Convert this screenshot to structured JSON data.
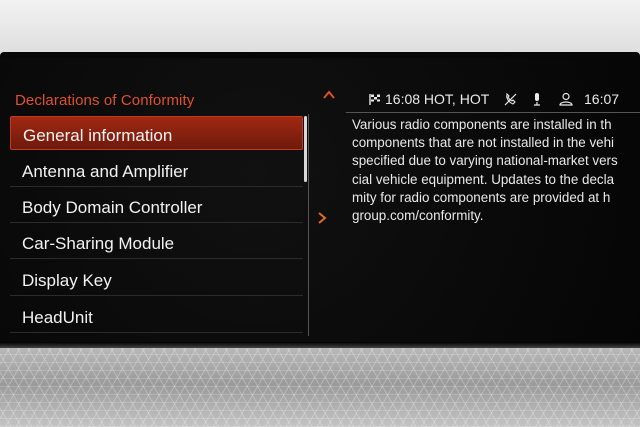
{
  "menu": {
    "title": "Declarations of Conformity",
    "items": [
      {
        "label": "General information",
        "selected": true
      },
      {
        "label": "Antenna and Amplifier",
        "selected": false
      },
      {
        "label": "Body Domain Controller",
        "selected": false
      },
      {
        "label": "Car-Sharing Module",
        "selected": false
      },
      {
        "label": "Display Key",
        "selected": false
      },
      {
        "label": "HeadUnit",
        "selected": false
      }
    ]
  },
  "status": {
    "nav_time": "16:08 HOT, HOT",
    "clock": "16:07",
    "icons": [
      "flag-icon",
      "phone-muted-icon",
      "microphone-icon",
      "user-icon"
    ]
  },
  "content": {
    "lines": [
      "Various radio components are installed in th",
      "components that are not installed in the vehi",
      "specified due to varying national-market vers",
      "cial vehicle equipment. Updates to the decla",
      "mity for radio components are provided at h",
      "group.com/conformity."
    ]
  },
  "colors": {
    "accent": "#e0502a",
    "selected_bg": "#8a2210",
    "text": "#f2f2f2",
    "screen_bg": "#070707"
  }
}
